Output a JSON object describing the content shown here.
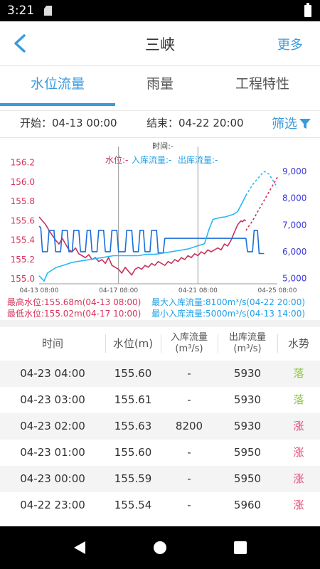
{
  "status_bar": {
    "time": "3:21"
  },
  "header": {
    "title": "三峡",
    "more_label": "更多"
  },
  "tabs": [
    {
      "label": "水位流量"
    },
    {
      "label": "雨量"
    },
    {
      "label": "工程特性"
    }
  ],
  "filter": {
    "start_label": "开始：04-13 00:00",
    "end_label": "结束：04-22 20:00",
    "screen_label": "筛选"
  },
  "chart_header": {
    "time_line": "时间:-",
    "water_level": "水位:-",
    "inflow": "入库流量:-",
    "outflow": "出库流量:-"
  },
  "chart_data": {
    "type": "line",
    "x_ticks": [
      "04-13 08:00",
      "04-17 08:00",
      "04-21 08:00",
      "04-25 08:00"
    ],
    "y_left": {
      "ticks": [
        "156.2",
        "156.0",
        "155.8",
        "155.6",
        "155.4",
        "155.2",
        "155.0"
      ],
      "range": [
        154.95,
        156.22
      ],
      "color": "#d6345c"
    },
    "y_right": {
      "ticks": [
        "9,000",
        "8,000",
        "7,000",
        "6,000",
        "5,000"
      ],
      "range": [
        4800,
        9400
      ],
      "color": "#3a3ad8"
    },
    "x_range": [
      0,
      288
    ],
    "vertical_markers": [
      96,
      192
    ],
    "series": [
      {
        "key": "water_level",
        "color": "#c8325a",
        "points": [
          [
            0,
            155.64
          ],
          [
            4,
            155.6
          ],
          [
            8,
            155.56
          ],
          [
            12,
            155.5
          ],
          [
            16,
            155.45
          ],
          [
            20,
            155.4
          ],
          [
            24,
            155.36
          ],
          [
            28,
            155.42
          ],
          [
            32,
            155.36
          ],
          [
            36,
            155.3
          ],
          [
            40,
            155.28
          ],
          [
            44,
            155.32
          ],
          [
            48,
            155.26
          ],
          [
            52,
            155.24
          ],
          [
            56,
            155.22
          ],
          [
            60,
            155.25
          ],
          [
            64,
            155.2
          ],
          [
            68,
            155.22
          ],
          [
            72,
            155.18
          ],
          [
            76,
            155.2
          ],
          [
            80,
            155.16
          ],
          [
            84,
            155.22
          ],
          [
            88,
            155.14
          ],
          [
            92,
            155.12
          ],
          [
            96,
            155.1
          ],
          [
            100,
            155.06
          ],
          [
            104,
            155.12
          ],
          [
            108,
            155.08
          ],
          [
            112,
            155.04
          ],
          [
            116,
            155.1
          ],
          [
            120,
            155.12
          ],
          [
            124,
            155.1
          ],
          [
            128,
            155.14
          ],
          [
            132,
            155.12
          ],
          [
            136,
            155.16
          ],
          [
            140,
            155.14
          ],
          [
            144,
            155.18
          ],
          [
            148,
            155.16
          ],
          [
            152,
            155.14
          ],
          [
            156,
            155.18
          ],
          [
            160,
            155.16
          ],
          [
            164,
            155.2
          ],
          [
            168,
            155.18
          ],
          [
            172,
            155.22
          ],
          [
            176,
            155.2
          ],
          [
            180,
            155.24
          ],
          [
            184,
            155.22
          ],
          [
            188,
            155.26
          ],
          [
            192,
            155.24
          ],
          [
            196,
            155.28
          ],
          [
            200,
            155.26
          ],
          [
            204,
            155.3
          ],
          [
            208,
            155.28
          ],
          [
            212,
            155.3
          ],
          [
            216,
            155.32
          ],
          [
            220,
            155.3
          ],
          [
            224,
            155.36
          ],
          [
            228,
            155.34
          ],
          [
            232,
            155.4
          ],
          [
            236,
            155.48
          ],
          [
            240,
            155.56
          ],
          [
            244,
            155.6
          ],
          [
            246,
            155.59
          ],
          [
            248,
            155.61
          ],
          [
            250,
            155.6
          ]
        ]
      },
      {
        "key": "water_level_forecast",
        "color": "#c8325a",
        "dashed": true,
        "points": [
          [
            250,
            155.5
          ],
          [
            258,
            155.6
          ],
          [
            266,
            155.72
          ],
          [
            274,
            155.84
          ],
          [
            282,
            155.96
          ],
          [
            288,
            156.05
          ]
        ]
      },
      {
        "key": "outflow",
        "color": "#1a6fd8",
        "points": [
          [
            0,
            6950
          ],
          [
            2,
            6900
          ],
          [
            4,
            6000
          ],
          [
            10,
            6000
          ],
          [
            12,
            6800
          ],
          [
            18,
            6800
          ],
          [
            20,
            6000
          ],
          [
            26,
            6000
          ],
          [
            28,
            6800
          ],
          [
            34,
            6800
          ],
          [
            36,
            6000
          ],
          [
            40,
            6000
          ],
          [
            42,
            6800
          ],
          [
            48,
            6800
          ],
          [
            50,
            6000
          ],
          [
            56,
            6000
          ],
          [
            58,
            6800
          ],
          [
            62,
            6800
          ],
          [
            64,
            6000
          ],
          [
            70,
            6000
          ],
          [
            72,
            6800
          ],
          [
            78,
            6800
          ],
          [
            80,
            6000
          ],
          [
            86,
            6000
          ],
          [
            88,
            6800
          ],
          [
            94,
            6800
          ],
          [
            96,
            6000
          ],
          [
            100,
            6000
          ],
          [
            104,
            6000
          ],
          [
            106,
            6800
          ],
          [
            112,
            6800
          ],
          [
            114,
            6000
          ],
          [
            120,
            6000
          ],
          [
            122,
            6800
          ],
          [
            126,
            6800
          ],
          [
            128,
            6000
          ],
          [
            134,
            6000
          ],
          [
            136,
            6800
          ],
          [
            142,
            6800
          ],
          [
            144,
            5960
          ],
          [
            150,
            5960
          ],
          [
            152,
            6500
          ],
          [
            250,
            6500
          ],
          [
            252,
            6000
          ],
          [
            258,
            6000
          ],
          [
            260,
            6800
          ],
          [
            264,
            6800
          ],
          [
            266,
            5930
          ],
          [
            272,
            5930
          ]
        ]
      },
      {
        "key": "inflow",
        "color": "#29b6f6",
        "points": [
          [
            0,
            5100
          ],
          [
            6,
            4900
          ],
          [
            10,
            5200
          ],
          [
            20,
            5400
          ],
          [
            30,
            5500
          ],
          [
            40,
            5600
          ],
          [
            50,
            5650
          ],
          [
            60,
            5700
          ],
          [
            70,
            5750
          ],
          [
            80,
            5800
          ],
          [
            90,
            5850
          ],
          [
            100,
            5850
          ],
          [
            110,
            5850
          ],
          [
            120,
            5850
          ],
          [
            130,
            5900
          ],
          [
            140,
            5900
          ],
          [
            150,
            5950
          ],
          [
            160,
            6000
          ],
          [
            170,
            6050
          ],
          [
            180,
            6100
          ],
          [
            190,
            6200
          ],
          [
            200,
            6300
          ],
          [
            205,
            6800
          ],
          [
            210,
            7200
          ],
          [
            215,
            7250
          ],
          [
            220,
            7280
          ],
          [
            225,
            7300
          ],
          [
            230,
            7350
          ],
          [
            235,
            7400
          ],
          [
            240,
            7500
          ],
          [
            245,
            7800
          ],
          [
            250,
            8100
          ]
        ]
      },
      {
        "key": "inflow_forecast",
        "color": "#29b6f6",
        "dashed": true,
        "points": [
          [
            250,
            8100
          ],
          [
            258,
            8500
          ],
          [
            266,
            8800
          ],
          [
            272,
            9000
          ],
          [
            278,
            8900
          ],
          [
            284,
            8600
          ],
          [
            288,
            8400
          ]
        ]
      }
    ]
  },
  "stats": {
    "max_level": "最高水位:155.68m(04-13 08:00)",
    "min_level": "最低水位:155.02m(04-17 10:00)",
    "max_inflow": "最大入库流量:8100m³/s(04-22 20:00)",
    "min_inflow": "最小入库流量:5000m³/s(04-13 14:00)"
  },
  "table": {
    "headers": {
      "time": "时间",
      "level": "水位(m)",
      "inflow_line1": "入库流量",
      "inflow_line2": "(m³/s)",
      "outflow_line1": "出库流量",
      "outflow_line2": "(m³/s)",
      "trend": "水势"
    },
    "rows": [
      {
        "time": "04-23 04:00",
        "level": "155.60",
        "inflow": "-",
        "outflow": "5930",
        "trend": "落"
      },
      {
        "time": "04-23 03:00",
        "level": "155.61",
        "inflow": "-",
        "outflow": "5930",
        "trend": "落"
      },
      {
        "time": "04-23 02:00",
        "level": "155.63",
        "inflow": "8200",
        "outflow": "5930",
        "trend": "涨"
      },
      {
        "time": "04-23 01:00",
        "level": "155.60",
        "inflow": "-",
        "outflow": "5950",
        "trend": "涨"
      },
      {
        "time": "04-23 00:00",
        "level": "155.59",
        "inflow": "-",
        "outflow": "5950",
        "trend": "涨"
      },
      {
        "time": "04-22 23:00",
        "level": "155.54",
        "inflow": "-",
        "outflow": "5960",
        "trend": "涨"
      }
    ]
  }
}
